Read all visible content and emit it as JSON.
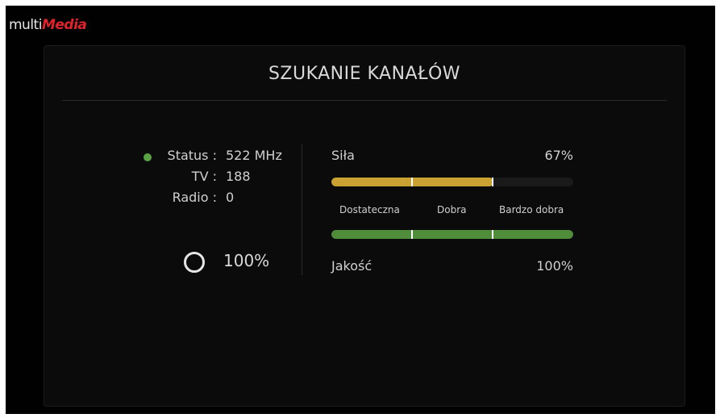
{
  "logo": {
    "text_light": "multi",
    "text_red": "Media"
  },
  "title": "SZUKANIE KANAŁÓW",
  "info": {
    "status_label": "Status :",
    "status_value": "522 MHz",
    "tv_label": "TV :",
    "tv_value": "188",
    "radio_label": "Radio :",
    "radio_value": "0"
  },
  "search_progress": {
    "value": "100%",
    "fraction": 1.0
  },
  "signal_strength": {
    "label": "Siła",
    "value": "67%",
    "fraction": 0.67,
    "color": "#c9a232"
  },
  "scale": {
    "labels": [
      "Dostateczna",
      "Dobra",
      "Bardzo dobra"
    ]
  },
  "signal_quality": {
    "label": "Jakość",
    "value": "100%",
    "fraction": 1.0,
    "color": "#4f8d3a"
  },
  "colors": {
    "status_ok": "#5aa245",
    "brand_red": "#e0232b"
  }
}
